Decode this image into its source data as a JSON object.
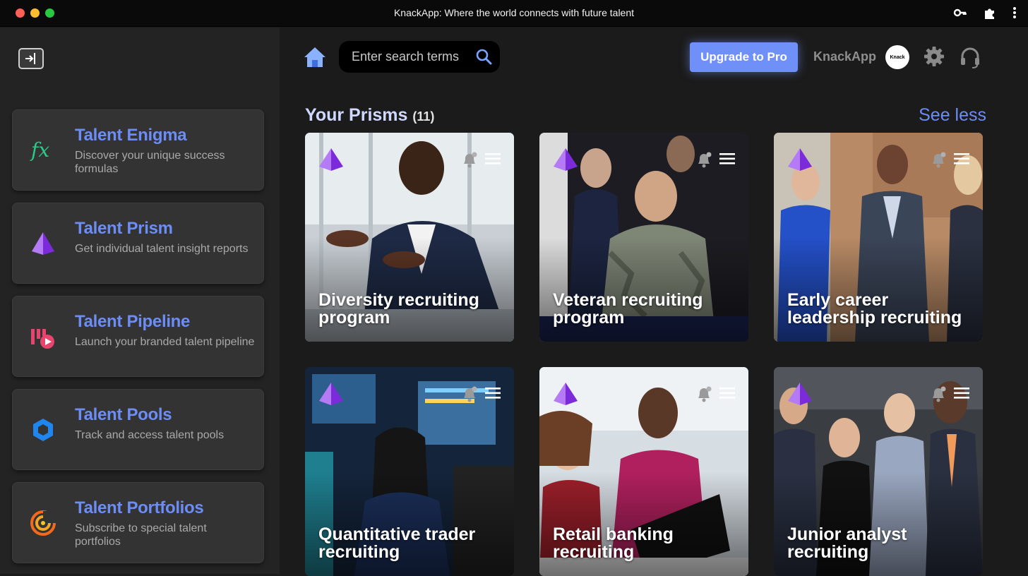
{
  "window": {
    "title": "KnackApp: Where the world connects with future talent"
  },
  "sidebar": {
    "items": [
      {
        "title": "Talent Enigma",
        "desc": "Discover your unique success formulas",
        "icon": "fx-icon"
      },
      {
        "title": "Talent Prism",
        "desc": "Get individual talent insight reports",
        "icon": "prism-icon"
      },
      {
        "title": "Talent Pipeline",
        "desc": "Launch your branded talent pipeline",
        "icon": "pipeline-icon"
      },
      {
        "title": "Talent Pools",
        "desc": "Track and access talent pools",
        "icon": "hexagon-icon"
      },
      {
        "title": "Talent Portfolios",
        "desc": "Subscribe to special talent portfolios",
        "icon": "portfolio-icon"
      }
    ]
  },
  "header": {
    "search_placeholder": "Enter search terms",
    "upgrade_label": "Upgrade to Pro",
    "brand": "KnackApp",
    "avatar_text": "Knack"
  },
  "prisms": {
    "title": "Your Prisms",
    "count": "(11)",
    "see_less": "See less",
    "tiles": [
      {
        "label": "Diversity recruiting program"
      },
      {
        "label": "Veteran recruiting program"
      },
      {
        "label": "Early career leadership recruiting"
      },
      {
        "label": "Quantitative trader recruiting"
      },
      {
        "label": "Retail banking recruiting"
      },
      {
        "label": "Junior analyst recruiting"
      }
    ]
  },
  "colors": {
    "accent": "#6d8df6",
    "upgrade_bg": "#6f8ff9",
    "sidebar_bg": "#232323",
    "card_bg": "#333333",
    "main_bg": "#1b1b1b"
  }
}
